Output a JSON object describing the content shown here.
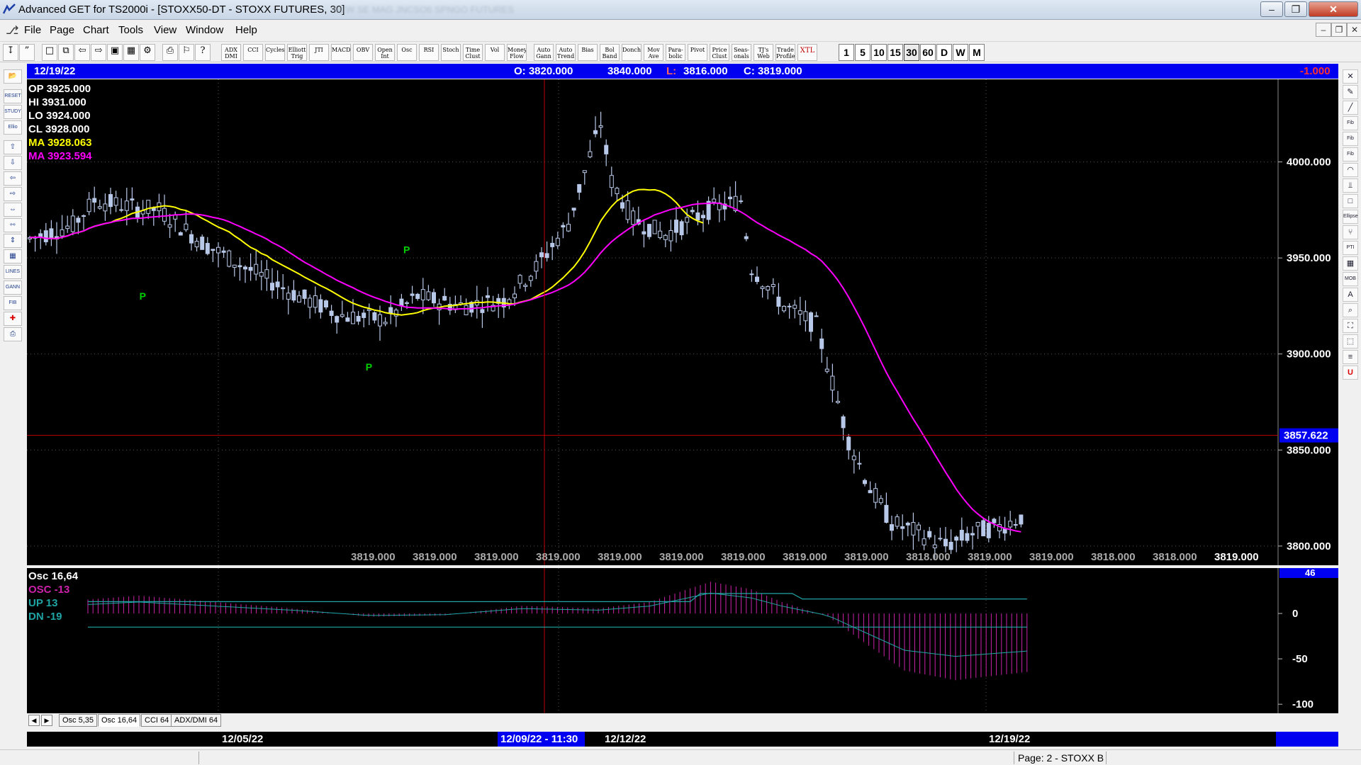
{
  "window": {
    "title": "Advanced GET for TS2000i - [STOXX50-DT - STOXX FUTURES, 30]",
    "blurred_title": "NEW SE MAG JNCSO6 SPNGO FUTURES"
  },
  "menu": [
    "File",
    "Page",
    "Chart",
    "Tools",
    "View",
    "Window",
    "Help"
  ],
  "toolbar": {
    "study_buttons": [
      "ADX DMI",
      "CCI",
      "Cycles",
      "Elliott Trig",
      "JTI",
      "MACD",
      "OBV",
      "Open Int",
      "Osc",
      "RSI",
      "Stoch",
      "Time Clust",
      "Vol",
      "Money Flow",
      "Auto Gann",
      "Auto Trend",
      "Bias",
      "Bol Band",
      "Donch",
      "Mov Ave",
      "Para-bolic",
      "Pivot",
      "Price Clust",
      "Seas-onals",
      "TJ's Web",
      "Trade Profile",
      "XTL"
    ],
    "timeframes": [
      "1",
      "5",
      "10",
      "15",
      "30",
      "60",
      "D",
      "W",
      "M"
    ],
    "active_timeframe": "30"
  },
  "left_tools": [
    "open-folder",
    "Reset",
    "Study",
    "Elliott",
    "arrow-up",
    "arrow-down",
    "arrow-left",
    "arrow-right",
    "zoom-h",
    "compress-h",
    "expand-v",
    "grid",
    "Lines",
    "Gann",
    "Fib",
    "crosshair",
    "print"
  ],
  "right_tools": [
    "X",
    "pencil",
    "line",
    "Fib Ret",
    "Fib Ext",
    "Fib Time",
    "arc",
    "fan",
    "box",
    "Ellipse",
    "pitchfork",
    "PTI",
    "grid",
    "MOB",
    "A",
    "magnifier",
    "bucket",
    "eraser",
    "notes",
    "U"
  ],
  "header": {
    "date": "12/19/22",
    "open": "O: 3820.000",
    "high": "3840.000",
    "low_label": "L:",
    "low": "3816.000",
    "close": "C: 3819.000",
    "change": "-1.000"
  },
  "readout": [
    {
      "label": "OP",
      "value": "3925.000",
      "color": "#ffffff"
    },
    {
      "label": "HI",
      "value": "3931.000",
      "color": "#ffffff"
    },
    {
      "label": "LO",
      "value": "3924.000",
      "color": "#ffffff"
    },
    {
      "label": "CL",
      "value": "3928.000",
      "color": "#ffffff"
    },
    {
      "label": "MA",
      "value": "3928.063",
      "color": "#ffff00"
    },
    {
      "label": "MA",
      "value": "3923.594",
      "color": "#ff00ff"
    }
  ],
  "y_axis": {
    "ticks": [
      "4000.000",
      "3950.000",
      "3900.000",
      "3850.000",
      "3800.000"
    ],
    "tick_values": [
      4000,
      3950,
      3900,
      3850,
      3800
    ],
    "range": [
      3790,
      4043
    ],
    "cursor_price": "3857.622",
    "cursor_value": 3857.622
  },
  "bottom_values": [
    "3819.000",
    "3819.000",
    "3819.000",
    "3819.000",
    "3819.000",
    "3819.000",
    "3819.000",
    "3819.000",
    "3819.000",
    "3818.000",
    "3819.000",
    "3819.000",
    "3818.000",
    "3818.000",
    "3819.000"
  ],
  "pivot_markers": [
    {
      "label": "P",
      "bar": 21,
      "value": 3935,
      "side": "below"
    },
    {
      "label": "P",
      "bar": 63,
      "value": 3898,
      "side": "below"
    },
    {
      "label": "P",
      "bar": 70,
      "value": 3948,
      "side": "above"
    }
  ],
  "oscillator": {
    "title": "Osc 16,64",
    "osc_label": "OSC -13",
    "up_label": "UP   13",
    "dn_label": "DN   -19",
    "ticks": [
      "46",
      "0",
      "-50",
      "-100"
    ],
    "tick_values": [
      0,
      -50,
      -100
    ],
    "range": [
      -110,
      50
    ]
  },
  "osc_tabs": [
    "Osc 5,35",
    "Osc 16,64",
    "CCI 64",
    "ADX/DMI 64"
  ],
  "active_osc_tab": "Osc 16,64",
  "date_axis": {
    "labels": [
      "12/05/22",
      "12/12/22",
      "12/19/22"
    ],
    "cursor_label": "12/09/22 - 11:30"
  },
  "status": {
    "page": "Page: 2 - STOXX B"
  },
  "colors": {
    "background": "#000000",
    "header": "#0000f0",
    "price_bars": "#b8c8e8",
    "ma_fast": "#ffff00",
    "ma_slow": "#ff00ff",
    "osc_histogram": "#cc22aa",
    "osc_band": "#1fa4a4",
    "crosshair": "#c00000",
    "pivot": "#00d000"
  }
}
